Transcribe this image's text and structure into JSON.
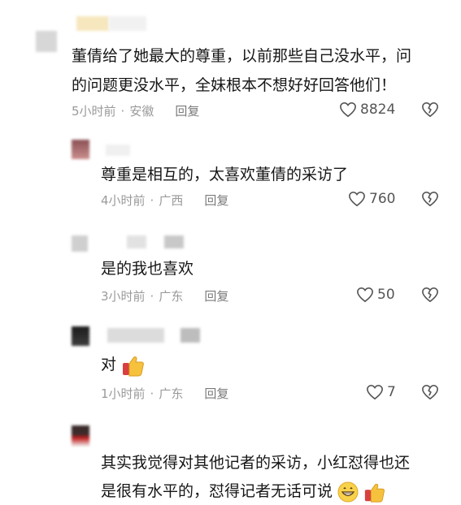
{
  "comments": [
    {
      "text_lines": [
        "董倩给了她最大的尊重，以前那些自己没水平，问",
        "的问题更没水平，全妹根本不想好好回答他们！"
      ],
      "time": "5小时前",
      "location": "安徽",
      "reply": "回复",
      "likes": "8824"
    },
    {
      "text_lines": [
        "尊重是相互的，太喜欢董倩的采访了"
      ],
      "time": "4小时前",
      "location": "广西",
      "reply": "回复",
      "likes": "760"
    },
    {
      "text_lines": [
        "是的我也喜欢"
      ],
      "time": "3小时前",
      "location": "广东",
      "reply": "回复",
      "likes": "50"
    },
    {
      "text_lines": [
        "对"
      ],
      "time": "1小时前",
      "location": "广东",
      "reply": "回复",
      "likes": "7"
    },
    {
      "text_lines": [
        "其实我觉得对其他记者的采访，小红怼得也还",
        "是很有水平的，怼得记者无话可说"
      ]
    }
  ],
  "icons": {
    "like": "heart-outline-icon",
    "dislike": "broken-heart-icon",
    "thumbs_up": "thumbs-up-emoji",
    "grin": "grinning-face-emoji"
  },
  "colors": {
    "meta": "#9a9a9a",
    "text": "#161616"
  }
}
